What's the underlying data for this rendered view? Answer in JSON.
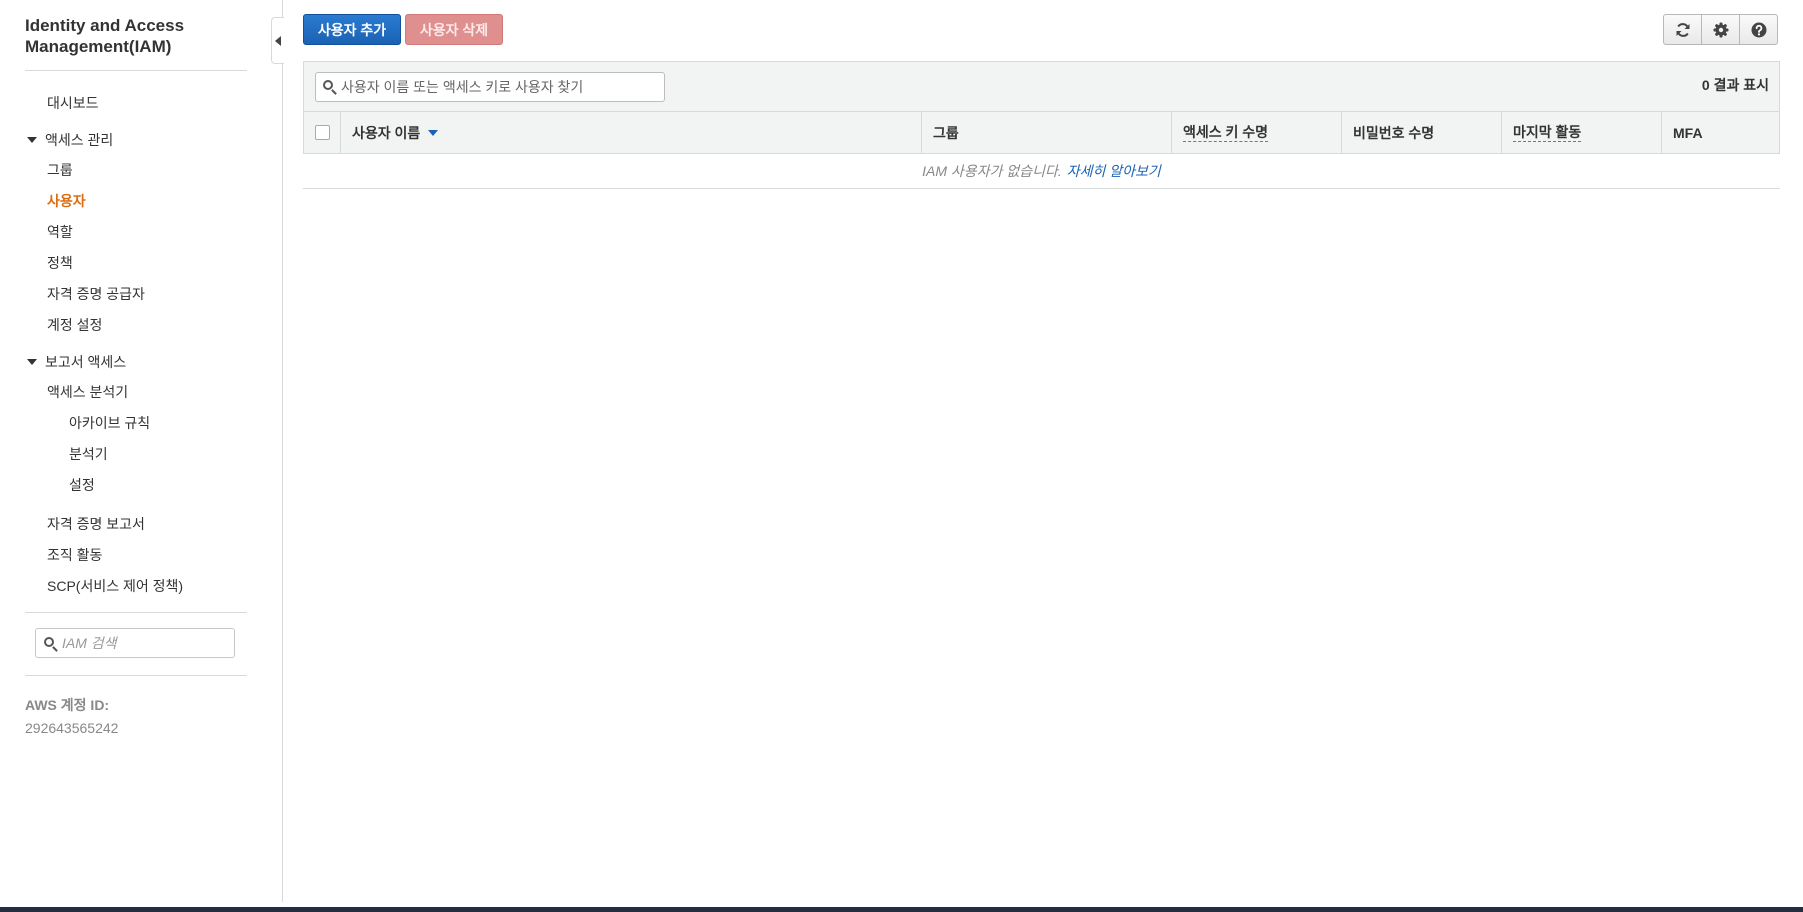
{
  "app": {
    "title": "Identity and Access Management(IAM)"
  },
  "sidebar": {
    "dashboard": "대시보드",
    "access_management": {
      "label": "액세스 관리",
      "items": [
        "그룹",
        "사용자",
        "역할",
        "정책",
        "자격 증명 공급자",
        "계정 설정"
      ],
      "active_item": "사용자"
    },
    "access_reports": {
      "label": "보고서 액세스",
      "analyzer": "액세스 분석기",
      "analyzer_children": [
        "아카이브 규칙",
        "분석기",
        "설정"
      ],
      "items": [
        "자격 증명 보고서",
        "조직 활동",
        "SCP(서비스 제어 정책)"
      ]
    },
    "search": {
      "placeholder": "IAM 검색",
      "icon": "search-icon"
    },
    "account": {
      "label": "AWS 계정 ID:",
      "id": "292643565242"
    }
  },
  "toolbar": {
    "add_user": "사용자 추가",
    "delete_user": "사용자 삭제",
    "icons": [
      "refresh-icon",
      "gear-icon",
      "help-icon"
    ]
  },
  "table": {
    "search_placeholder": "사용자 이름 또는 액세스 키로 사용자 찾기",
    "result_count": "0 결과 표시",
    "columns": [
      "사용자 이름",
      "그룹",
      "액세스 키 수명",
      "비밀번호 수명",
      "마지막 활동",
      "MFA"
    ],
    "sorted_column": "사용자 이름",
    "empty_message": "IAM 사용자가 없습니다.",
    "learn_more": "자세히 알아보기"
  },
  "colors": {
    "primary": "#1a62b3",
    "danger_disabled": "#e08f8f",
    "active_nav": "#dd6b10",
    "border": "#d5dbdb",
    "footer": "#232f3e"
  }
}
